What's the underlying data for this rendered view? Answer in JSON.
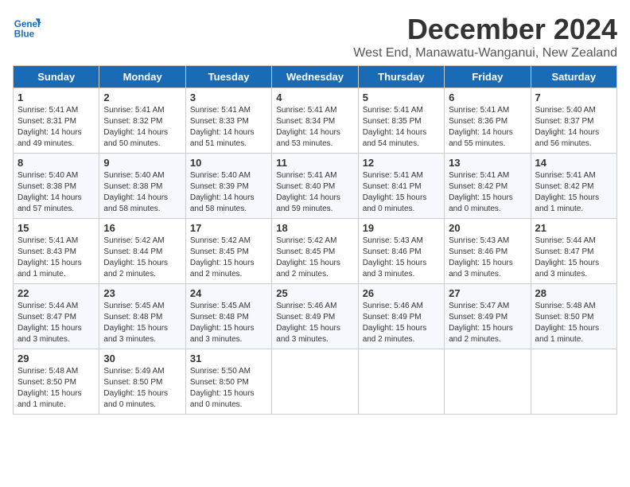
{
  "logo": {
    "line1": "General",
    "line2": "Blue"
  },
  "title": "December 2024",
  "location": "West End, Manawatu-Wanganui, New Zealand",
  "days_of_week": [
    "Sunday",
    "Monday",
    "Tuesday",
    "Wednesday",
    "Thursday",
    "Friday",
    "Saturday"
  ],
  "weeks": [
    [
      {
        "day": "1",
        "sunrise": "5:41 AM",
        "sunset": "8:31 PM",
        "daylight": "14 hours and 49 minutes."
      },
      {
        "day": "2",
        "sunrise": "5:41 AM",
        "sunset": "8:32 PM",
        "daylight": "14 hours and 50 minutes."
      },
      {
        "day": "3",
        "sunrise": "5:41 AM",
        "sunset": "8:33 PM",
        "daylight": "14 hours and 51 minutes."
      },
      {
        "day": "4",
        "sunrise": "5:41 AM",
        "sunset": "8:34 PM",
        "daylight": "14 hours and 53 minutes."
      },
      {
        "day": "5",
        "sunrise": "5:41 AM",
        "sunset": "8:35 PM",
        "daylight": "14 hours and 54 minutes."
      },
      {
        "day": "6",
        "sunrise": "5:41 AM",
        "sunset": "8:36 PM",
        "daylight": "14 hours and 55 minutes."
      },
      {
        "day": "7",
        "sunrise": "5:40 AM",
        "sunset": "8:37 PM",
        "daylight": "14 hours and 56 minutes."
      }
    ],
    [
      {
        "day": "8",
        "sunrise": "5:40 AM",
        "sunset": "8:38 PM",
        "daylight": "14 hours and 57 minutes."
      },
      {
        "day": "9",
        "sunrise": "5:40 AM",
        "sunset": "8:38 PM",
        "daylight": "14 hours and 58 minutes."
      },
      {
        "day": "10",
        "sunrise": "5:40 AM",
        "sunset": "8:39 PM",
        "daylight": "14 hours and 58 minutes."
      },
      {
        "day": "11",
        "sunrise": "5:41 AM",
        "sunset": "8:40 PM",
        "daylight": "14 hours and 59 minutes."
      },
      {
        "day": "12",
        "sunrise": "5:41 AM",
        "sunset": "8:41 PM",
        "daylight": "15 hours and 0 minutes."
      },
      {
        "day": "13",
        "sunrise": "5:41 AM",
        "sunset": "8:42 PM",
        "daylight": "15 hours and 0 minutes."
      },
      {
        "day": "14",
        "sunrise": "5:41 AM",
        "sunset": "8:42 PM",
        "daylight": "15 hours and 1 minute."
      }
    ],
    [
      {
        "day": "15",
        "sunrise": "5:41 AM",
        "sunset": "8:43 PM",
        "daylight": "15 hours and 1 minute."
      },
      {
        "day": "16",
        "sunrise": "5:42 AM",
        "sunset": "8:44 PM",
        "daylight": "15 hours and 2 minutes."
      },
      {
        "day": "17",
        "sunrise": "5:42 AM",
        "sunset": "8:45 PM",
        "daylight": "15 hours and 2 minutes."
      },
      {
        "day": "18",
        "sunrise": "5:42 AM",
        "sunset": "8:45 PM",
        "daylight": "15 hours and 2 minutes."
      },
      {
        "day": "19",
        "sunrise": "5:43 AM",
        "sunset": "8:46 PM",
        "daylight": "15 hours and 3 minutes."
      },
      {
        "day": "20",
        "sunrise": "5:43 AM",
        "sunset": "8:46 PM",
        "daylight": "15 hours and 3 minutes."
      },
      {
        "day": "21",
        "sunrise": "5:44 AM",
        "sunset": "8:47 PM",
        "daylight": "15 hours and 3 minutes."
      }
    ],
    [
      {
        "day": "22",
        "sunrise": "5:44 AM",
        "sunset": "8:47 PM",
        "daylight": "15 hours and 3 minutes."
      },
      {
        "day": "23",
        "sunrise": "5:45 AM",
        "sunset": "8:48 PM",
        "daylight": "15 hours and 3 minutes."
      },
      {
        "day": "24",
        "sunrise": "5:45 AM",
        "sunset": "8:48 PM",
        "daylight": "15 hours and 3 minutes."
      },
      {
        "day": "25",
        "sunrise": "5:46 AM",
        "sunset": "8:49 PM",
        "daylight": "15 hours and 3 minutes."
      },
      {
        "day": "26",
        "sunrise": "5:46 AM",
        "sunset": "8:49 PM",
        "daylight": "15 hours and 2 minutes."
      },
      {
        "day": "27",
        "sunrise": "5:47 AM",
        "sunset": "8:49 PM",
        "daylight": "15 hours and 2 minutes."
      },
      {
        "day": "28",
        "sunrise": "5:48 AM",
        "sunset": "8:50 PM",
        "daylight": "15 hours and 1 minute."
      }
    ],
    [
      {
        "day": "29",
        "sunrise": "5:48 AM",
        "sunset": "8:50 PM",
        "daylight": "15 hours and 1 minute."
      },
      {
        "day": "30",
        "sunrise": "5:49 AM",
        "sunset": "8:50 PM",
        "daylight": "15 hours and 0 minutes."
      },
      {
        "day": "31",
        "sunrise": "5:50 AM",
        "sunset": "8:50 PM",
        "daylight": "15 hours and 0 minutes."
      },
      null,
      null,
      null,
      null
    ]
  ],
  "labels": {
    "sunrise": "Sunrise:",
    "sunset": "Sunset:",
    "daylight": "Daylight:"
  }
}
